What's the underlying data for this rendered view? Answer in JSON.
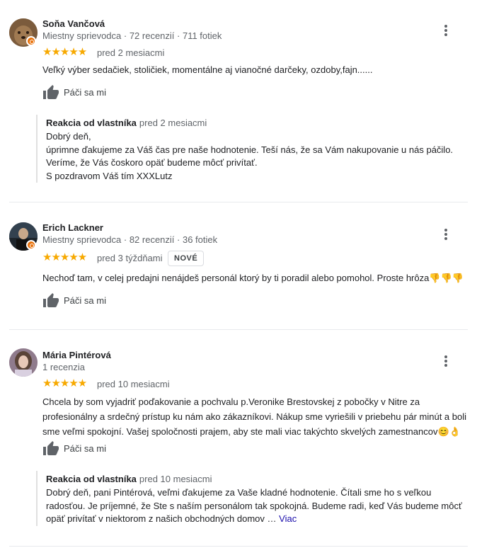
{
  "reviews": [
    {
      "name": "Soňa Vančová",
      "meta": "Miestny sprievodca · 72 recenzií · 711 fotiek",
      "stars": "★★★★★",
      "rating": 5,
      "when": "pred 2 mesiacmi",
      "text": "Veľký výber sedačiek, stoličiek, momentálne aj vianočné darčeky, ozdoby,fajn......",
      "like_label": "Páči sa mi",
      "reply": {
        "title": "Reakcia od vlastníka",
        "when": "pred 2 mesiacmi",
        "lines": [
          "Dobrý deň,",
          "úprimne ďakujeme za Váš čas pre naše hodnotenie. Teší nás, že sa Vám nakupovanie u nás páčilo.",
          "Veríme, že Vás čoskoro opäť budeme môcť privítať.",
          "S pozdravom Váš tím XXXLutz"
        ]
      },
      "colors": {
        "avatar_bg": "#8a6a4a"
      }
    },
    {
      "name": "Erich Lackner",
      "meta": "Miestny sprievodca · 82 recenzií · 36 fotiek",
      "stars": "★★★★★",
      "rating": 5,
      "when": "pred 3 týždňami",
      "badge": "NOVÉ",
      "text": "Nechoď tam, v celej predajni nenájdeš personál ktorý by ti poradil alebo pomohol. Proste hrôza",
      "text_emoji": "👎👎👎",
      "like_label": "Páči sa mi",
      "colors": {
        "avatar_bg": "#2b3a4a"
      }
    },
    {
      "name": "Mária Pintérová",
      "meta": "1 recenzia",
      "stars": "★★★★★",
      "rating": 5,
      "when": "pred 10 mesiacmi",
      "text": "Chcela by som vyjadriť poďakovanie a pochvalu p.Veronike Brestovskej z pobočky v Nitre za profesionálny a srdečný prístup ku nám ako zákazníkovi. Nákup sme vyriešili v priebehu pár minút a boli sme veľmi spokojní. Vašej spoločnosti prajem, aby ste mali viac takýchto skvelých zamestnancov",
      "text_emoji": "😊👌",
      "like_label": "Páči sa mi",
      "reply": {
        "title": "Reakcia od vlastníka",
        "when": "pred 10 mesiacmi",
        "text": "Dobrý deň, pani Pintérová, veľmi ďakujeme za Vaše kladné hodnotenie. Čítali sme ho s veľkou radosťou. Je príjemné, že Ste s naším personálom tak spokojná. Budeme radi, keď Vás budeme môcť opäť privítať v niektorom z našich obchodných domov …",
        "more": "Viac"
      },
      "colors": {
        "avatar_bg": "#c9b0c8"
      }
    }
  ],
  "icons": {
    "like": "thumbs-up-icon",
    "menu": "more-vert-icon",
    "local_guide": "local-guide-badge-icon"
  },
  "colors": {
    "star": "#f7a900",
    "muted": "#5f6368",
    "link": "#1a0dab",
    "badge": "#e8710a"
  }
}
